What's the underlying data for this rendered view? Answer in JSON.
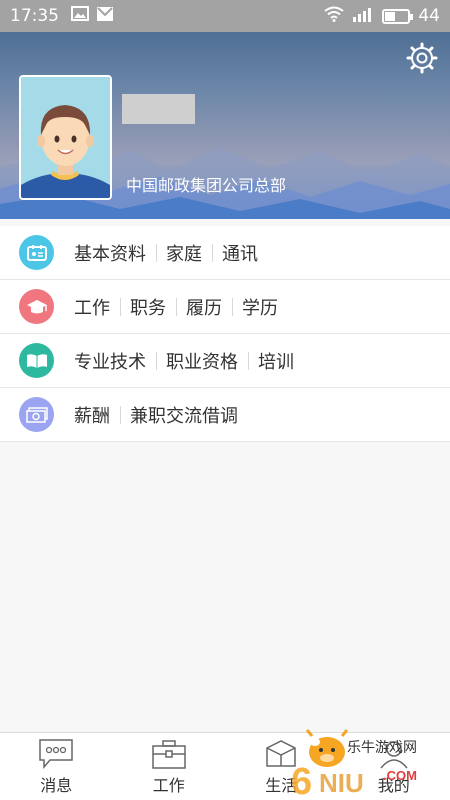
{
  "status_bar": {
    "time": "17:35",
    "battery_level": "44"
  },
  "profile": {
    "organization": "中国邮政集团公司总部"
  },
  "menu": {
    "rows": [
      {
        "icon": "id-card-icon",
        "color": "#4cc6e6",
        "items": [
          "基本资料",
          "家庭",
          "通讯"
        ]
      },
      {
        "icon": "graduation-cap-icon",
        "color": "#f0767f",
        "items": [
          "工作",
          "职务",
          "履历",
          "学历"
        ]
      },
      {
        "icon": "book-icon",
        "color": "#2eb8a0",
        "items": [
          "专业技术",
          "职业资格",
          "培训"
        ]
      },
      {
        "icon": "money-icon",
        "color": "#9aa4f0",
        "items": [
          "薪酬",
          "兼职交流借调"
        ]
      }
    ]
  },
  "bottom_nav": {
    "items": [
      {
        "label": "消息",
        "icon": "message-icon"
      },
      {
        "label": "工作",
        "icon": "briefcase-icon"
      },
      {
        "label": "生活",
        "icon": "life-icon"
      },
      {
        "label": "我的",
        "icon": "profile-icon"
      }
    ]
  },
  "watermark": {
    "text": "乐牛游戏网",
    "logo": "6NIU.COM"
  }
}
